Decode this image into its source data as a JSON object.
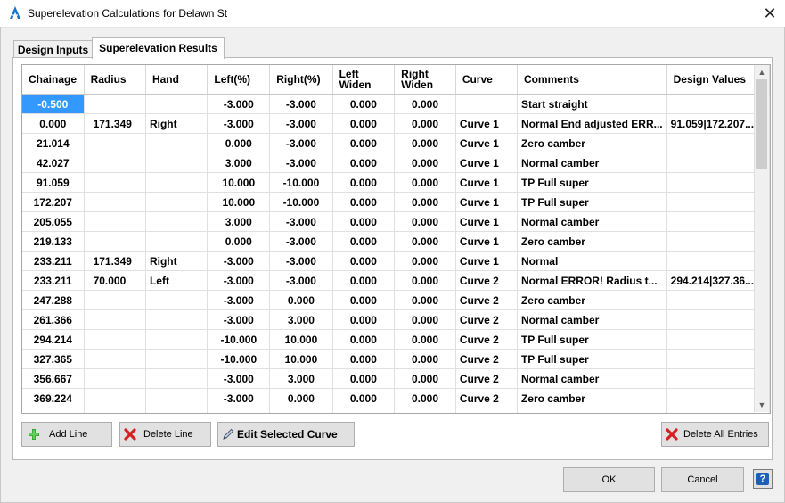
{
  "window": {
    "title": "Superelevation Calculations for Delawn St"
  },
  "tabs": [
    {
      "label": "Design Inputs"
    },
    {
      "label": "Superelevation Results"
    }
  ],
  "table": {
    "headers": [
      "Chainage",
      "Radius",
      "Hand",
      "Left(%)",
      "Right(%)",
      "Left Widen",
      "Right Widen",
      "Curve",
      "Comments",
      "Design Values"
    ],
    "header_lines": {
      "left_widen": [
        "Left",
        "Widen"
      ],
      "right_widen": [
        "Right",
        "Widen"
      ]
    },
    "rows": [
      [
        "-0.500",
        "",
        "",
        "-3.000",
        "-3.000",
        "0.000",
        "0.000",
        "",
        "Start straight",
        ""
      ],
      [
        "0.000",
        "171.349",
        "Right",
        "-3.000",
        "-3.000",
        "0.000",
        "0.000",
        "Curve 1",
        "Normal End adjusted ERR...",
        "91.059|172.207..."
      ],
      [
        "21.014",
        "",
        "",
        "0.000",
        "-3.000",
        "0.000",
        "0.000",
        "Curve 1",
        "Zero camber",
        ""
      ],
      [
        "42.027",
        "",
        "",
        "3.000",
        "-3.000",
        "0.000",
        "0.000",
        "Curve 1",
        "Normal camber",
        ""
      ],
      [
        "91.059",
        "",
        "",
        "10.000",
        "-10.000",
        "0.000",
        "0.000",
        "Curve 1",
        "TP Full super",
        ""
      ],
      [
        "172.207",
        "",
        "",
        "10.000",
        "-10.000",
        "0.000",
        "0.000",
        "Curve 1",
        "TP Full super",
        ""
      ],
      [
        "205.055",
        "",
        "",
        "3.000",
        "-3.000",
        "0.000",
        "0.000",
        "Curve 1",
        "Normal camber",
        ""
      ],
      [
        "219.133",
        "",
        "",
        "0.000",
        "-3.000",
        "0.000",
        "0.000",
        "Curve 1",
        "Zero camber",
        ""
      ],
      [
        "233.211",
        "171.349",
        "Right",
        "-3.000",
        "-3.000",
        "0.000",
        "0.000",
        "Curve 1",
        "Normal",
        ""
      ],
      [
        "233.211",
        "70.000",
        "Left",
        "-3.000",
        "-3.000",
        "0.000",
        "0.000",
        "Curve 2",
        "Normal ERROR! Radius t...",
        "294.214|327.36..."
      ],
      [
        "247.288",
        "",
        "",
        "-3.000",
        "0.000",
        "0.000",
        "0.000",
        "Curve 2",
        "Zero camber",
        ""
      ],
      [
        "261.366",
        "",
        "",
        "-3.000",
        "3.000",
        "0.000",
        "0.000",
        "Curve 2",
        "Normal camber",
        ""
      ],
      [
        "294.214",
        "",
        "",
        "-10.000",
        "10.000",
        "0.000",
        "0.000",
        "Curve 2",
        "TP Full super",
        ""
      ],
      [
        "327.365",
        "",
        "",
        "-10.000",
        "10.000",
        "0.000",
        "0.000",
        "Curve 2",
        "TP Full super",
        ""
      ],
      [
        "356.667",
        "",
        "",
        "-3.000",
        "3.000",
        "0.000",
        "0.000",
        "Curve 2",
        "Normal camber",
        ""
      ],
      [
        "369.224",
        "",
        "",
        "-3.000",
        "0.000",
        "0.000",
        "0.000",
        "Curve 2",
        "Zero camber",
        ""
      ]
    ],
    "selected_cell": {
      "row": 0,
      "column": "Chainage"
    }
  },
  "buttons": {
    "add_line": "Add Line",
    "delete_line": "Delete Line",
    "edit_curve": "Edit Selected Curve",
    "delete_all": "Delete All Entries",
    "ok": "OK",
    "cancel": "Cancel",
    "help": "?"
  },
  "icons": {
    "app": "autodesk-a-icon",
    "close": "close-icon",
    "add": "green-plus-icon",
    "delete": "red-x-icon",
    "edit": "pencil-icon",
    "help": "help-icon"
  },
  "colors": {
    "selection": "#3399ff",
    "app_icon": "#1a73c7",
    "add_icon": "#2e9e2e",
    "delete_icon": "#d42020"
  }
}
